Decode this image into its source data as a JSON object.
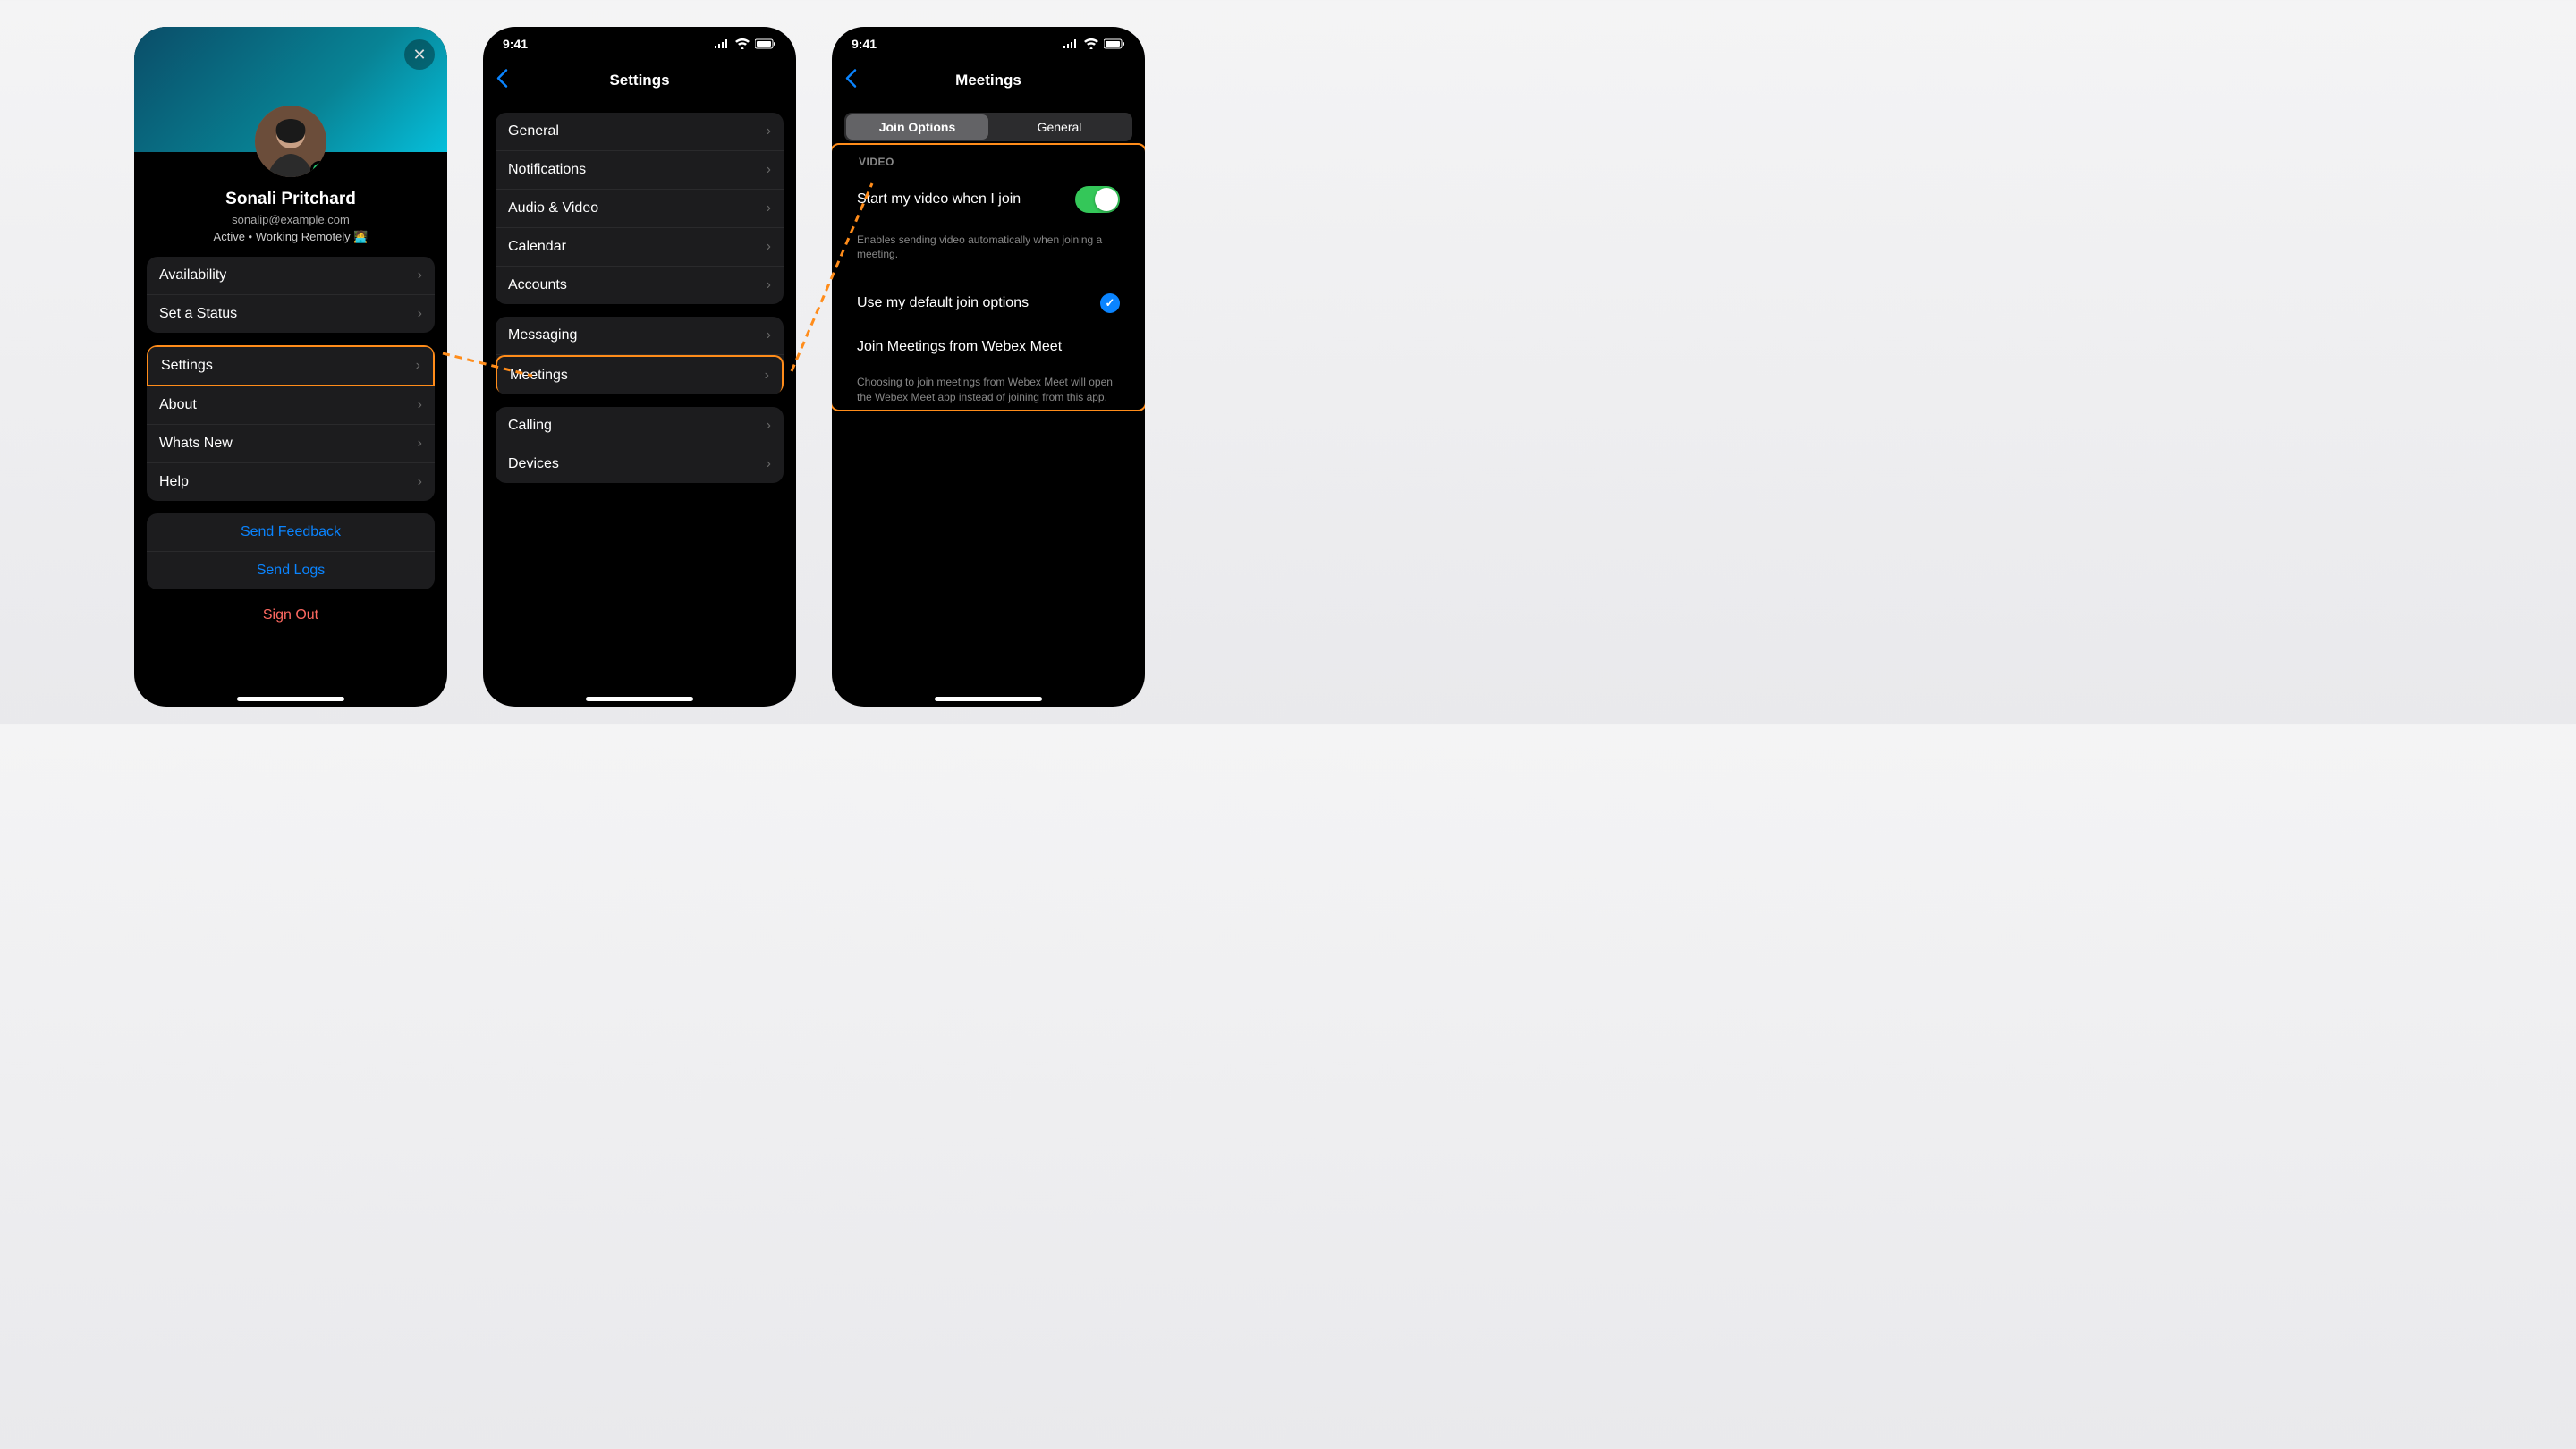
{
  "statusbar": {
    "time": "9:41"
  },
  "phone1": {
    "user_name": "Sonali Pritchard",
    "user_email": "sonalip@example.com",
    "user_status": "Active • Working Remotely 🧑‍💻",
    "groupA": [
      "Availability",
      "Set a Status"
    ],
    "groupB": [
      "Settings",
      "About",
      "Whats New",
      "Help"
    ],
    "groupC": [
      "Send Feedback",
      "Send Logs"
    ],
    "sign_out": "Sign Out"
  },
  "phone2": {
    "title": "Settings",
    "groupA": [
      "General",
      "Notifications",
      "Audio & Video",
      "Calendar",
      "Accounts"
    ],
    "groupB": [
      "Messaging",
      "Meetings"
    ],
    "groupC": [
      "Calling",
      "Devices"
    ]
  },
  "phone3": {
    "title": "Meetings",
    "tabs": [
      "Join Options",
      "General"
    ],
    "video_label": "VIDEO",
    "start_video": "Start my video when I join",
    "start_video_desc": "Enables sending video automatically when joining a meeting.",
    "use_default": "Use my default join options",
    "join_webex": "Join Meetings from Webex Meet",
    "join_webex_desc": "Choosing to join meetings from Webex Meet will open the Webex Meet app instead of joining from this app."
  },
  "colors": {
    "accent": "#0a84ff",
    "highlight": "#ff8c1a"
  }
}
